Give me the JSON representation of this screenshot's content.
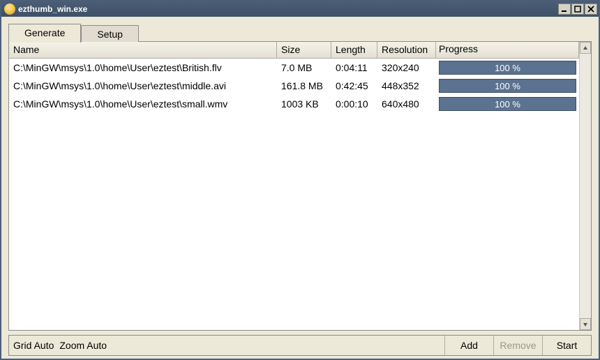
{
  "window": {
    "title": "ezthumb_win.exe"
  },
  "tabs": {
    "generate": "Generate",
    "setup": "Setup"
  },
  "columns": {
    "name": "Name",
    "size": "Size",
    "length": "Length",
    "resolution": "Resolution",
    "progress": "Progress"
  },
  "rows": [
    {
      "name": "C:\\MinGW\\msys\\1.0\\home\\User\\eztest\\British.flv",
      "size": "7.0 MB",
      "length": "0:04:11",
      "resolution": "320x240",
      "progress": "100 %"
    },
    {
      "name": "C:\\MinGW\\msys\\1.0\\home\\User\\eztest\\middle.avi",
      "size": "161.8 MB",
      "length": "0:42:45",
      "resolution": "448x352",
      "progress": "100 %"
    },
    {
      "name": "C:\\MinGW\\msys\\1.0\\home\\User\\eztest\\small.wmv",
      "size": "1003 KB",
      "length": "0:00:10",
      "resolution": "640x480",
      "progress": "100 %"
    }
  ],
  "status": {
    "grid": "Grid Auto",
    "zoom": "Zoom Auto"
  },
  "buttons": {
    "add": "Add",
    "remove": "Remove",
    "start": "Start"
  }
}
